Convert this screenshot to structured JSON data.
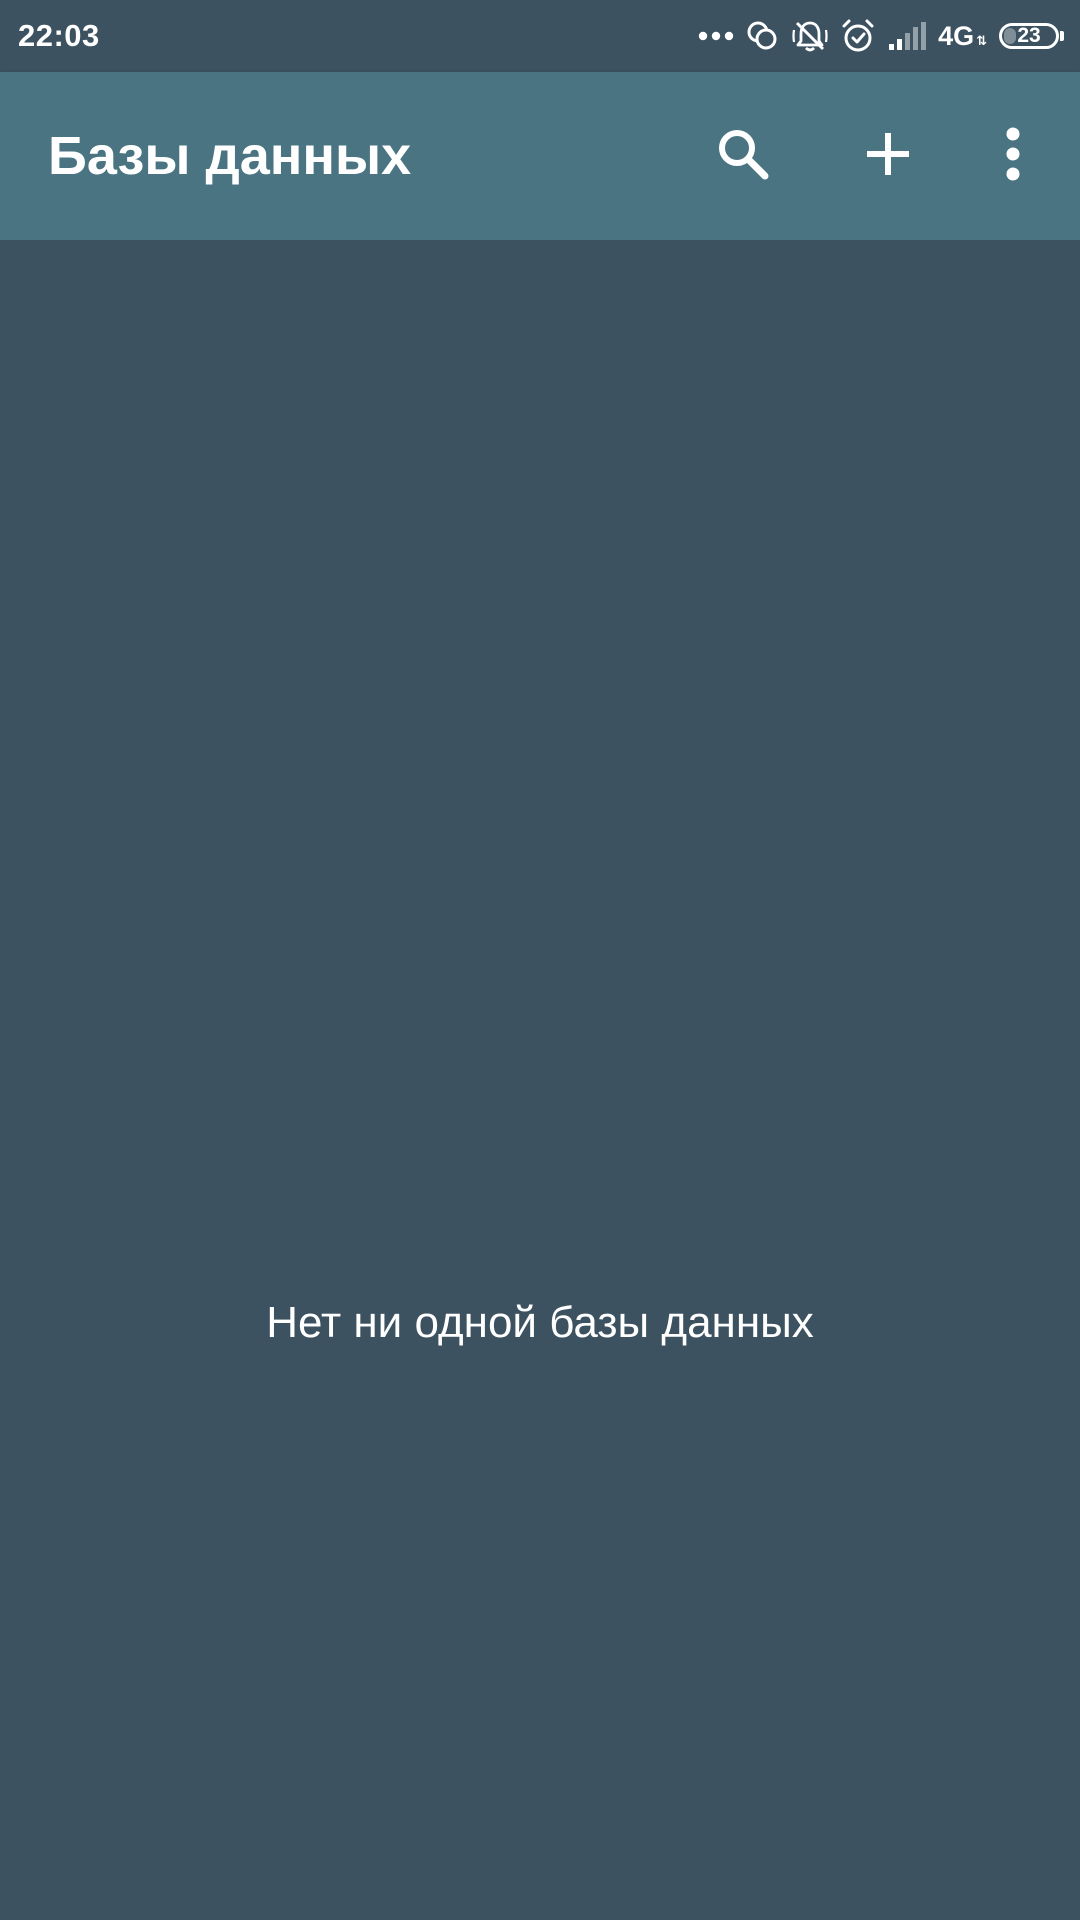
{
  "status_bar": {
    "time": "22:03",
    "network_type": "4G",
    "network_arrows": "⇅",
    "battery_level": "23",
    "battery_fraction": 0.23,
    "icons": [
      "more-notifications-icon",
      "sync-icon",
      "silent-bell-icon",
      "alarm-icon",
      "signal-icon",
      "network-4g-icon",
      "battery-icon"
    ]
  },
  "app_bar": {
    "title": "Базы данных",
    "actions": [
      "search-icon",
      "add-icon",
      "more-vert-icon"
    ]
  },
  "content": {
    "empty_message": "Нет ни одной базы данных"
  },
  "colors": {
    "background": "#3c5260",
    "app_bar": "#4b7482",
    "text": "#ffffff"
  }
}
